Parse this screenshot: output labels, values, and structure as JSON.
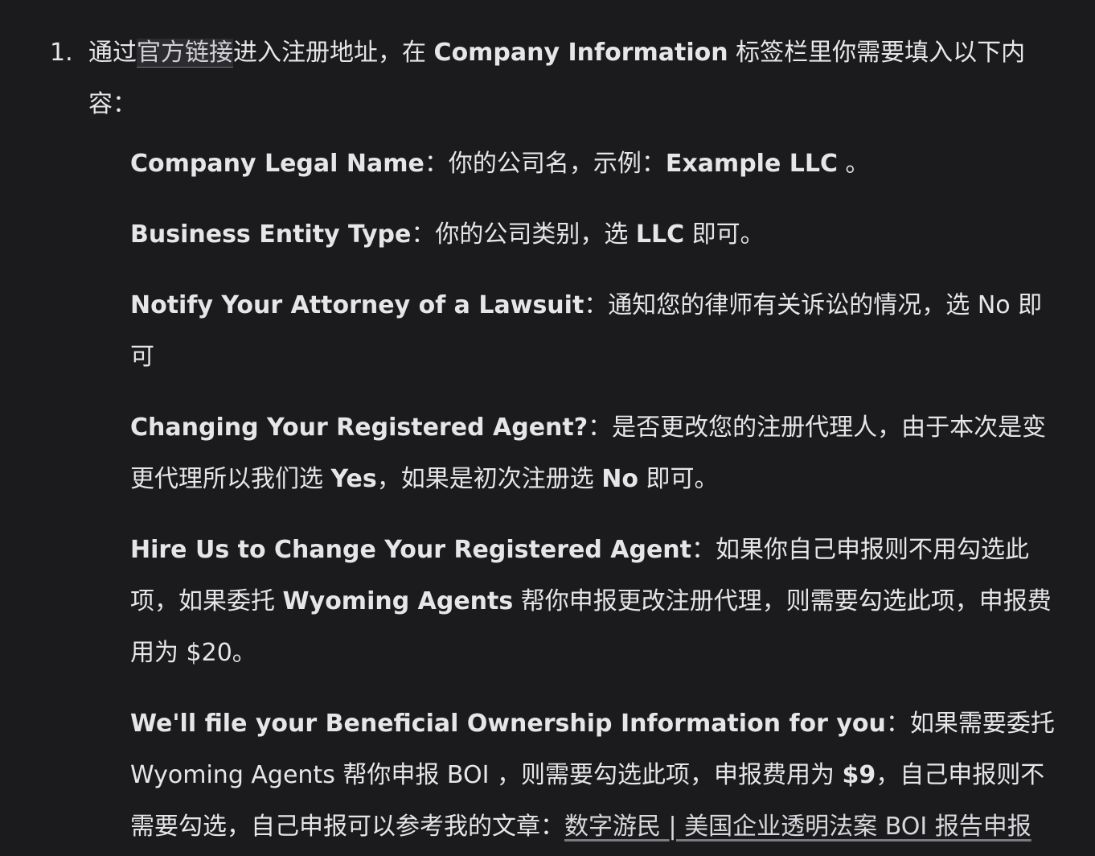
{
  "step": {
    "number": "1.",
    "text_before_link": "通过",
    "link_text": "官方链接",
    "text_after_link": "进入注册地址，在 ",
    "tab_name": "Company Information",
    "text_end": " 标签栏里你需要填入以下内容："
  },
  "items": [
    {
      "label": "Company Legal Name",
      "sep": "：",
      "text1": "你的公司名，示例：",
      "bold1": "Example LLC",
      "text2": " 。"
    },
    {
      "label": "Business Entity Type",
      "sep": "：",
      "text1": "你的公司类别，选 ",
      "bold1": "LLC",
      "text2": " 即可。"
    },
    {
      "label": "Notify Your Attorney of a Lawsuit",
      "sep": "：",
      "text1": "通知您的律师有关诉讼的情况，选 No 即可"
    },
    {
      "label": "Changing Your Registered Agent?",
      "sep": "：",
      "text1": "是否更改您的注册代理人，由于本次是变更代理所以我们选 ",
      "bold1": "Yes",
      "text2": "，如果是初次注册选 ",
      "bold2": "No",
      "text3": " 即可。"
    },
    {
      "label": "Hire Us to Change Your Registered Agent",
      "sep": "：",
      "text1": "如果你自己申报则不用勾选此项，如果委托 ",
      "bold1": "Wyoming Agents",
      "text2": " 帮你申报更改注册代理，则需要勾选此项，申报费用为 $20。"
    },
    {
      "label": "We'll file your Beneficial Ownership Information for you",
      "sep": "：",
      "text1": "如果需要委托 Wyoming Agents 帮你申报 BOI ，则需要勾选此项，申报费用为 ",
      "bold1": "$9",
      "text2": "，自己申报则不需要勾选，自己申报可以参考我的文章：",
      "link": "数字游民 | 美国企业透明法案 BOI 报告申报"
    }
  ]
}
